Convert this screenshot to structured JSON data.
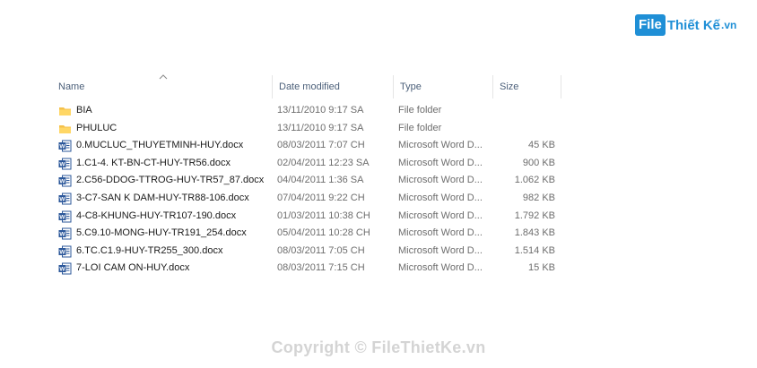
{
  "watermark": {
    "logo_box": "File",
    "logo_name": "Thiết Kế",
    "logo_tld": ".vn",
    "copyright": "Copyright © FileThietKe.vn",
    "brand_color": "#1f8fd6"
  },
  "columns": {
    "name": "Name",
    "date": "Date modified",
    "type": "Type",
    "size": "Size",
    "sort_icon": "chevron-up-icon"
  },
  "files": [
    {
      "name": "BIA",
      "date": "13/11/2010 9:17 SA",
      "type": "File folder",
      "size": "",
      "icon": "folder-icon"
    },
    {
      "name": "PHULUC",
      "date": "13/11/2010 9:17 SA",
      "type": "File folder",
      "size": "",
      "icon": "folder-icon"
    },
    {
      "name": "0.MUCLUC_THUYETMINH-HUY.docx",
      "date": "08/03/2011 7:07 CH",
      "type": "Microsoft Word D...",
      "size": "45 KB",
      "icon": "word-doc-icon"
    },
    {
      "name": "1.C1-4. KT-BN-CT-HUY-TR56.docx",
      "date": "02/04/2011 12:23 SA",
      "type": "Microsoft Word D...",
      "size": "900 KB",
      "icon": "word-doc-icon"
    },
    {
      "name": "2.C56-DDOG-TTROG-HUY-TR57_87.docx",
      "date": "04/04/2011 1:36 SA",
      "type": "Microsoft Word D...",
      "size": "1.062 KB",
      "icon": "word-doc-icon"
    },
    {
      "name": "3-C7-SAN K DAM-HUY-TR88-106.docx",
      "date": "07/04/2011 9:22 CH",
      "type": "Microsoft Word D...",
      "size": "982 KB",
      "icon": "word-doc-icon"
    },
    {
      "name": "4-C8-KHUNG-HUY-TR107-190.docx",
      "date": "01/03/2011 10:38 CH",
      "type": "Microsoft Word D...",
      "size": "1.792 KB",
      "icon": "word-doc-icon"
    },
    {
      "name": "5.C9.10-MONG-HUY-TR191_254.docx",
      "date": "05/04/2011 10:28 CH",
      "type": "Microsoft Word D...",
      "size": "1.843 KB",
      "icon": "word-doc-icon"
    },
    {
      "name": "6.TC.C1.9-HUY-TR255_300.docx",
      "date": "08/03/2011 7:05 CH",
      "type": "Microsoft Word D...",
      "size": "1.514 KB",
      "icon": "word-doc-icon"
    },
    {
      "name": "7-LOI CAM ON-HUY.docx",
      "date": "08/03/2011 7:15 CH",
      "type": "Microsoft Word D...",
      "size": "15 KB",
      "icon": "word-doc-icon"
    }
  ]
}
